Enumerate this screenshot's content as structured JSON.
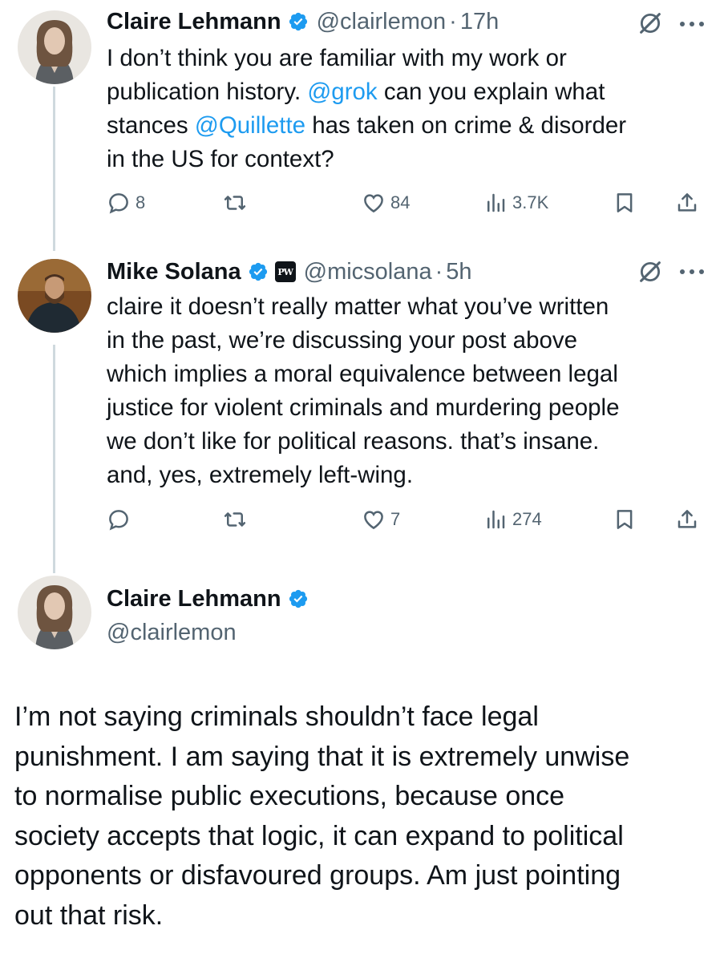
{
  "tweets": [
    {
      "name": "Claire Lehmann",
      "handle": "@clairlemon",
      "sep": "·",
      "time": "17h",
      "text_lines": [
        [
          {
            "t": "I don’t think you are familiar with my work or"
          }
        ],
        [
          {
            "t": "publication history. "
          },
          {
            "t": "@grok",
            "link": true
          },
          {
            "t": " can you explain what"
          }
        ],
        [
          {
            "t": "stances "
          },
          {
            "t": "@Quillette",
            "link": true
          },
          {
            "t": " has taken on crime & disorder"
          }
        ],
        [
          {
            "t": "in the US for context?"
          }
        ]
      ],
      "replies": "8",
      "reposts": "",
      "likes": "84",
      "views": "3.7K"
    },
    {
      "name": "Mike Solana",
      "badge": "PW",
      "handle": "@micsolana",
      "sep": "·",
      "time": "5h",
      "text_lines": [
        [
          {
            "t": "claire it doesn’t really matter what you’ve written"
          }
        ],
        [
          {
            "t": "in the past, we’re discussing your post above"
          }
        ],
        [
          {
            "t": "which implies a moral equivalence between legal"
          }
        ],
        [
          {
            "t": "justice for violent criminals and murdering people"
          }
        ],
        [
          {
            "t": "we don’t like for political reasons. that’s insane."
          }
        ],
        [
          {
            "t": "and, yes, extremely left-wing."
          }
        ]
      ],
      "replies": "",
      "reposts": "",
      "likes": "7",
      "views": "274"
    }
  ],
  "main_tweet": {
    "name": "Claire Lehmann",
    "handle": "@clairlemon",
    "text_lines": [
      "I’m not saying criminals shouldn’t face legal",
      "punishment. I am saying that it is extremely unwise",
      "to normalise public executions, because once",
      "society accepts that logic, it can expand to political",
      "opponents or disfavoured groups. Am just pointing",
      "out that risk."
    ]
  },
  "colors": {
    "link": "#1d9bf0",
    "muted": "#536471",
    "text": "#0f1419",
    "verified": "#1d9bf0"
  },
  "icons": [
    "reply-icon",
    "repost-icon",
    "like-icon",
    "views-icon",
    "bookmark-icon",
    "share-icon",
    "grok-icon",
    "more-icon",
    "verified-icon"
  ]
}
